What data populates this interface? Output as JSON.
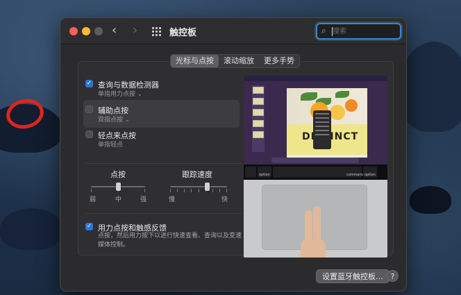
{
  "window": {
    "title": "触控板",
    "search_placeholder": "搜索"
  },
  "tabs": [
    {
      "label": "光标与点按",
      "active": true
    },
    {
      "label": "滚动缩放",
      "active": false
    },
    {
      "label": "更多手势",
      "active": false
    }
  ],
  "options": {
    "lookup": {
      "label": "查询与数据检测器",
      "sub": "单指用力点按",
      "checked": true
    },
    "secondary_click": {
      "label": "辅助点按",
      "sub": "双指点按",
      "checked": false
    },
    "tap_to_click": {
      "label": "轻点来点按",
      "sub": "单指轻点",
      "checked": false
    },
    "force_click": {
      "label": "用力点按和触感反馈",
      "description": "点按，然后用力按下以进行快速查看、查询以及变速媒体控制。",
      "checked": true
    }
  },
  "sliders": {
    "click": {
      "title": "点按",
      "labels": [
        "弱",
        "中",
        "强"
      ],
      "value_step": 1,
      "steps": 3
    },
    "tracking": {
      "title": "跟踪速度",
      "labels": [
        "慢",
        "快"
      ],
      "value_fraction": 0.62
    }
  },
  "preview": {
    "banner_text": "DISTINCT",
    "keys": [
      {
        "label": "command"
      },
      {
        "label": "option"
      },
      {
        "label": "command"
      },
      {
        "label": "option"
      }
    ]
  },
  "footer": {
    "bluetooth_button": "设置蓝牙触控板…",
    "help_label": "?"
  },
  "colors": {
    "accent": "#2f75d6",
    "annotation_ring": "#e0231f",
    "window_bg": "#2b2b2d"
  }
}
